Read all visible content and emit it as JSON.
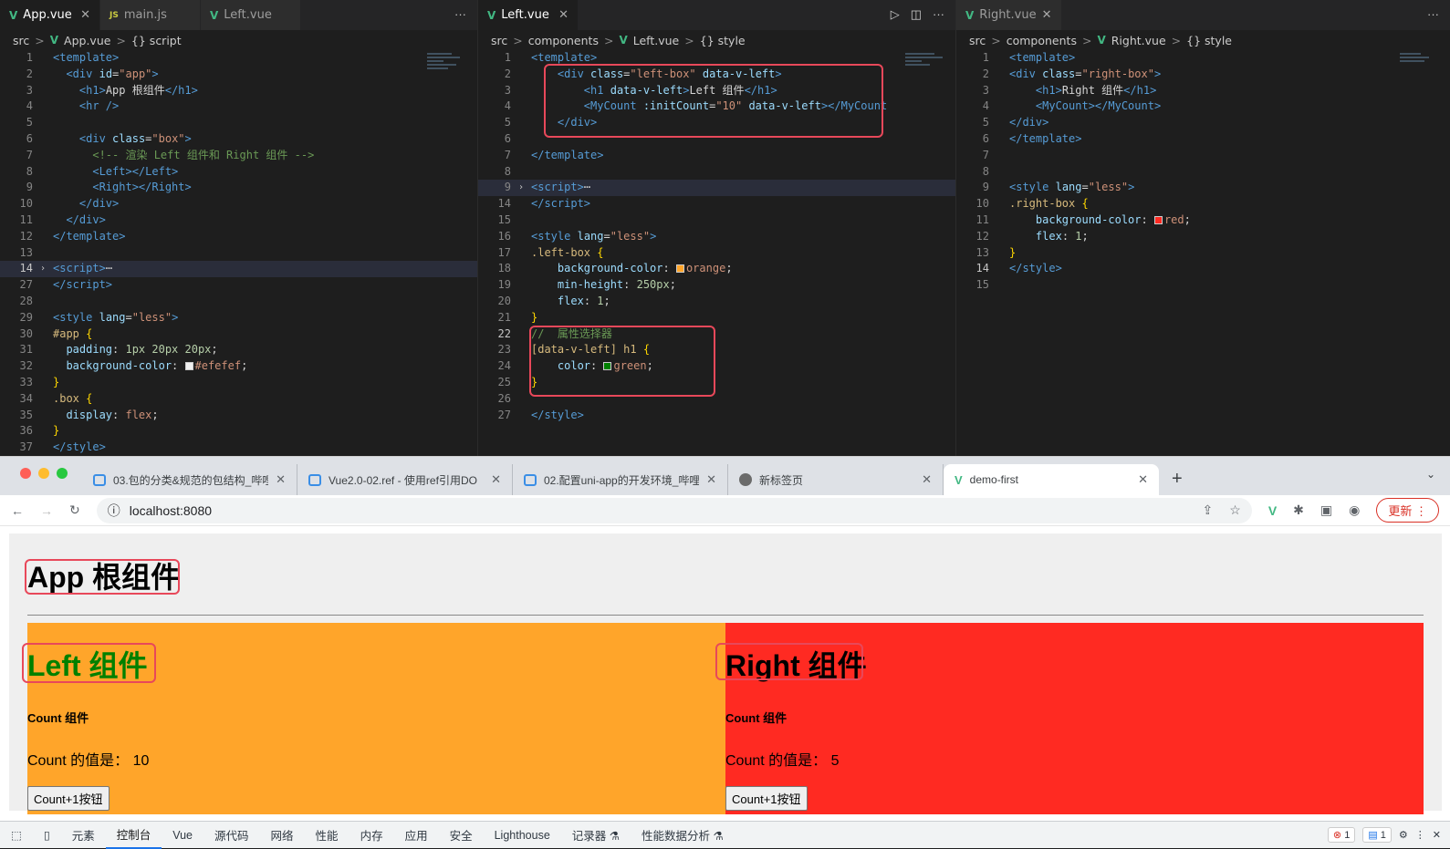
{
  "pane1": {
    "tabs": [
      {
        "icon": "V",
        "label": "App.vue"
      },
      {
        "icon": "JS",
        "label": "main.js"
      },
      {
        "icon": "V",
        "label": "Left.vue"
      }
    ],
    "crumbs": [
      "src",
      "App.vue",
      "{} script"
    ],
    "more": "···"
  },
  "pane2": {
    "tabs": [
      {
        "icon": "V",
        "label": "Left.vue"
      }
    ],
    "crumbs": [
      "src",
      "components",
      "Left.vue",
      "{} style"
    ],
    "more": "···"
  },
  "pane3": {
    "tabs": [
      {
        "icon": "V",
        "label": "Right.vue"
      }
    ],
    "crumbs": [
      "src",
      "components",
      "Right.vue",
      "{} style"
    ],
    "more": "···"
  },
  "browser": {
    "tabs": [
      {
        "label": "03.包的分类&规范的包结构_哔哩"
      },
      {
        "label": "Vue2.0-02.ref - 使用ref引用DO"
      },
      {
        "label": "02.配置uni-app的开发环境_哔哩"
      },
      {
        "label": "新标签页"
      },
      {
        "label": "demo-first"
      }
    ],
    "url": "localhost:8080",
    "update_label": "更新"
  },
  "page": {
    "app_title": "App 根组件",
    "left_title": "Left 组件",
    "right_title": "Right 组件",
    "count_heading": "Count 组件",
    "left_count_text": "Count 的值是： 10",
    "right_count_text": "Count 的值是： 5",
    "button_label": "Count+1按钮"
  },
  "devtools": {
    "tabs": [
      "元素",
      "控制台",
      "Vue",
      "源代码",
      "网络",
      "性能",
      "内存",
      "应用",
      "安全",
      "Lighthouse",
      "记录器 ⚗",
      "性能数据分析 ⚗"
    ],
    "active": "控制台",
    "errors": "1",
    "messages": "1"
  },
  "colors": {
    "orange": "#ffa52a",
    "red": "#ff2a22",
    "green": "#008000",
    "app_bg": "#efefef",
    "vue": "#42b883",
    "highlight_box": "#e8485a"
  }
}
